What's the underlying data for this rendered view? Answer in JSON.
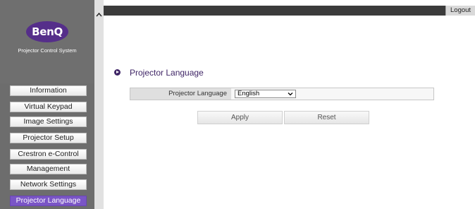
{
  "sidebar": {
    "brand": "BenQ",
    "system_title": "Projector Control System",
    "items": [
      {
        "label": "Information"
      },
      {
        "label": "Virtual Keypad"
      },
      {
        "label": "Image Settings"
      },
      {
        "label": "Projector Setup"
      },
      {
        "label": "Crestron e-Control"
      },
      {
        "label": "Management"
      },
      {
        "label": "Network Settings"
      },
      {
        "label": "Projector Language",
        "active": true
      }
    ]
  },
  "header": {
    "logout_label": "Logout"
  },
  "main": {
    "section_title": "Projector Language",
    "field_label": "Projector Language",
    "field_value": "English",
    "apply_label": "Apply",
    "reset_label": "Reset"
  },
  "colors": {
    "accent": "#7a55c6",
    "brand": "#552e8a",
    "title": "#3f2566"
  },
  "icons": {
    "scroll_up": "chevron-up-icon",
    "select_arrow": "chevron-down-icon",
    "section": "play-circle-icon"
  }
}
